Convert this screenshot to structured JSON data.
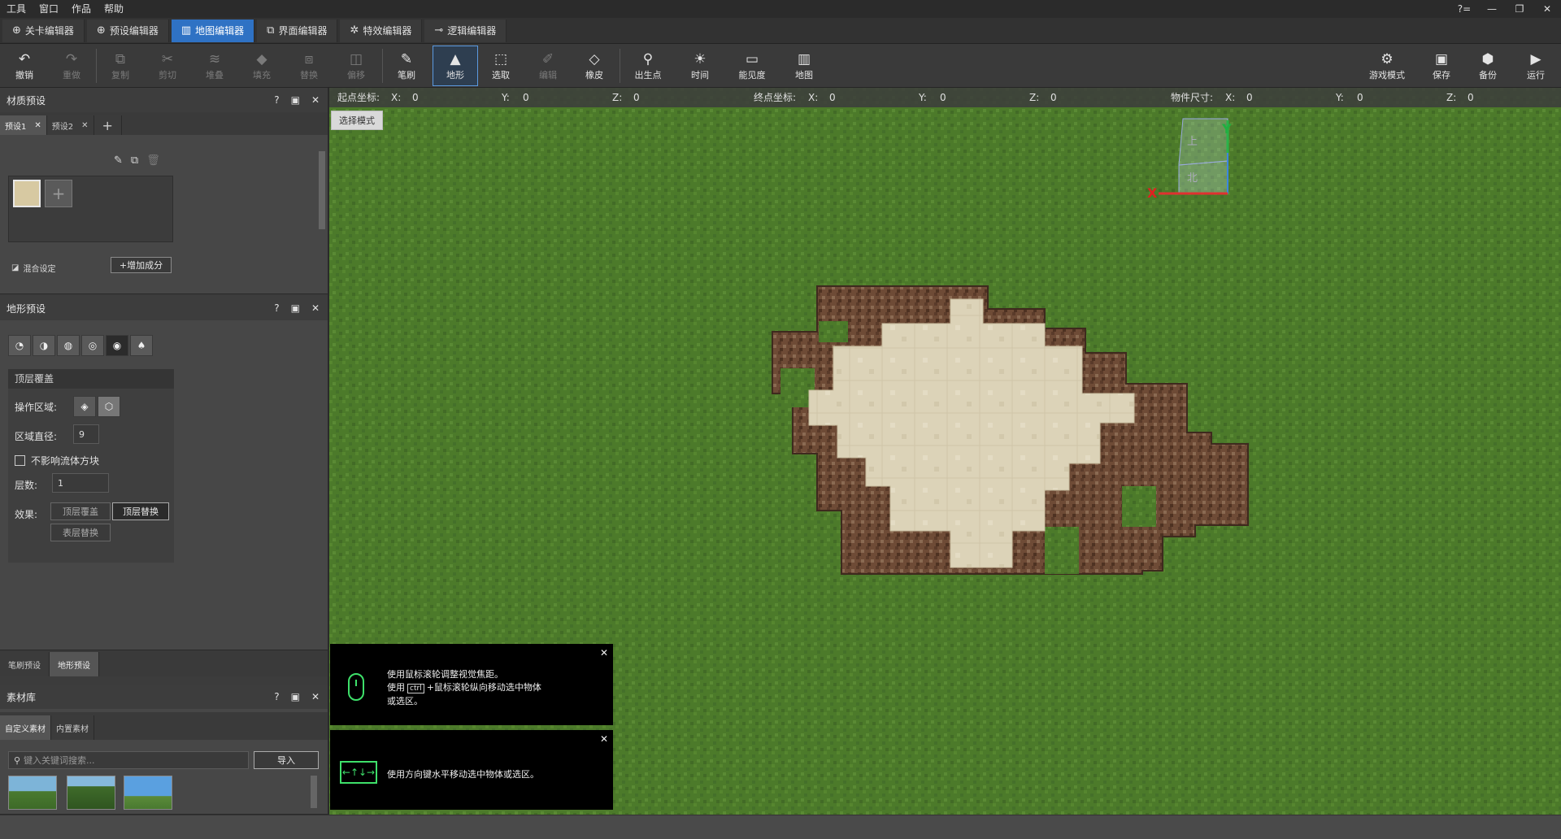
{
  "menu": [
    "工具",
    "窗口",
    "作品",
    "帮助"
  ],
  "window_controls": [
    "?=",
    "—",
    "❐",
    "✕"
  ],
  "editor_tabs": [
    {
      "label": "关卡编辑器",
      "icon": "target-icon"
    },
    {
      "label": "预设编辑器",
      "icon": "target-icon"
    },
    {
      "label": "地图编辑器",
      "icon": "map-icon"
    },
    {
      "label": "界面编辑器",
      "icon": "window-icon"
    },
    {
      "label": "特效编辑器",
      "icon": "sparkle-icon"
    },
    {
      "label": "逻辑编辑器",
      "icon": "node-icon"
    }
  ],
  "toolbar": {
    "undo": "撤销",
    "redo": "重做",
    "copy": "复制",
    "cut": "剪切",
    "stack": "堆叠",
    "fill": "填充",
    "replace": "替换",
    "offset": "偏移",
    "brush": "笔刷",
    "terrain": "地形",
    "select": "选取",
    "edit": "编辑",
    "eraser": "橡皮",
    "spawn": "出生点",
    "time": "时间",
    "visibility": "能见度",
    "map": "地图",
    "game_mode": "游戏模式",
    "save": "保存",
    "backup": "备份",
    "run": "运行"
  },
  "material_panel": {
    "title": "材质预设",
    "tabs": [
      "预设1",
      "预设2"
    ],
    "blend": "混合设定",
    "add_component": "增加成分"
  },
  "terrain_panel": {
    "title": "地形预设",
    "section": "顶层覆盖",
    "op_area": "操作区域:",
    "diameter_label": "区域直径:",
    "diameter": "9",
    "no_fluid": "不影响流体方块",
    "layers_label": "层数:",
    "layers": "1",
    "effect_label": "效果:",
    "effects": [
      "顶层覆盖",
      "顶层替换",
      "表层替换"
    ]
  },
  "bottom_tabs": [
    "笔刷预设",
    "地形预设"
  ],
  "library": {
    "title": "素材库",
    "tabs": [
      "自定义素材",
      "内置素材"
    ],
    "search_placeholder": "键入关键词搜索...",
    "import": "导入"
  },
  "viewport": {
    "mode": "选择模式",
    "start_label": "起点坐标:",
    "end_label": "终点坐标:",
    "size_label": "物件尺寸:",
    "x": "X:",
    "y": "Y:",
    "z": "Z:",
    "zero": "0",
    "gizmo_top": "上",
    "gizmo_front": "北"
  },
  "hints": {
    "scroll_line1": "使用鼠标滚轮调整视觉焦距。",
    "scroll_line2a": "使用",
    "ctrl_key": "ctrl",
    "scroll_line2b": "+鼠标滚轮纵向移动选中物体",
    "scroll_line3": "或选区。",
    "arrow": "使用方向键水平移动选中物体或选区。"
  },
  "colors": {
    "accent": "#2f72c4",
    "grass": "#4f7a2c",
    "sand": "#dcd3b8",
    "dirt": "#6b4a36"
  }
}
